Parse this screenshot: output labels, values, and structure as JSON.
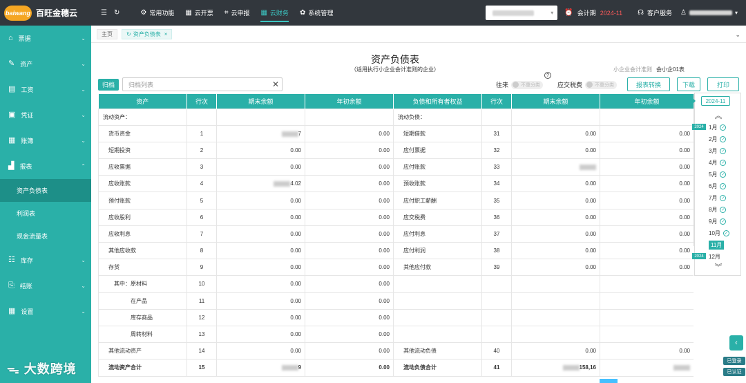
{
  "brand": {
    "logo": "baiwang",
    "name": "百旺金穗云"
  },
  "nav": {
    "items": [
      {
        "label": "常用功能",
        "icon": "sliders-icon"
      },
      {
        "label": "云开票",
        "icon": "grid-icon"
      },
      {
        "label": "云申报",
        "icon": "crop-icon"
      },
      {
        "label": "云财务",
        "icon": "grid-icon"
      },
      {
        "label": "系统管理",
        "icon": "gear-icon"
      }
    ],
    "active_index": 3
  },
  "header": {
    "period_label": "会计期",
    "period_value": "2024-11",
    "service_label": "客户服务"
  },
  "sidebar": {
    "items": [
      {
        "label": "票据"
      },
      {
        "label": "资产"
      },
      {
        "label": "工资"
      },
      {
        "label": "凭证"
      },
      {
        "label": "账簿"
      },
      {
        "label": "报表"
      }
    ],
    "sub_items": [
      {
        "label": "资产负债表"
      },
      {
        "label": "利润表"
      },
      {
        "label": "现金流量表"
      }
    ],
    "bottom_items": [
      {
        "label": "库存"
      },
      {
        "label": "结账"
      },
      {
        "label": "设置"
      }
    ]
  },
  "tabs": [
    {
      "label": "主页"
    },
    {
      "label": "资产负债表"
    }
  ],
  "report": {
    "title": "资产负债表",
    "subtitle": "（适用执行小企业会计准则的企业）",
    "standard_label": "小企业会计准则",
    "standard_value": "会小企01表"
  },
  "toolbar": {
    "archive_button": "归档",
    "archive_placeholder": "归档列表",
    "toggle1_label": "往来",
    "toggle2_label": "应交税费",
    "toggle_text": "不重分类",
    "convert_button": "报表转换",
    "download_button": "下载",
    "print_button": "打印"
  },
  "table": {
    "headers": [
      "资产",
      "行次",
      "期末余额",
      "年初余额",
      "负债和所有者权益",
      "行次",
      "期末余额",
      "年初余额"
    ],
    "rows": [
      {
        "a": "流动资产：",
        "an": "",
        "ae": "",
        "ab": "",
        "l": "流动负债：",
        "ln": "",
        "le": "",
        "lb": "",
        "ai": 0,
        "li": 0
      },
      {
        "a": "货币资金",
        "an": "1",
        "ae": "7",
        "ab": "0.00",
        "l": "短期借款",
        "ln": "31",
        "le": "0.00",
        "lb": "0.00",
        "ai": 1,
        "li": 1,
        "ae_blur": true
      },
      {
        "a": "短期投资",
        "an": "2",
        "ae": "0.00",
        "ab": "0.00",
        "l": "应付票据",
        "ln": "32",
        "le": "0.00",
        "lb": "0.00",
        "ai": 1,
        "li": 1
      },
      {
        "a": "应收票据",
        "an": "3",
        "ae": "0.00",
        "ab": "0.00",
        "l": "应付账款",
        "ln": "33",
        "le": "",
        "lb": "0.00",
        "ai": 1,
        "li": 1,
        "le_blur": true
      },
      {
        "a": "应收账款",
        "an": "4",
        "ae": "4.02",
        "ab": "0.00",
        "l": "预收账款",
        "ln": "34",
        "le": "0.00",
        "lb": "0.00",
        "ai": 1,
        "li": 1,
        "ae_blur": true
      },
      {
        "a": "预付账款",
        "an": "5",
        "ae": "0.00",
        "ab": "0.00",
        "l": "应付职工薪酬",
        "ln": "35",
        "le": "0.00",
        "lb": "0.00",
        "ai": 1,
        "li": 1
      },
      {
        "a": "应收股利",
        "an": "6",
        "ae": "0.00",
        "ab": "0.00",
        "l": "应交税费",
        "ln": "36",
        "le": "0.00",
        "lb": "0.00",
        "ai": 1,
        "li": 1
      },
      {
        "a": "应收利息",
        "an": "7",
        "ae": "0.00",
        "ab": "0.00",
        "l": "应付利息",
        "ln": "37",
        "le": "0.00",
        "lb": "0.00",
        "ai": 1,
        "li": 1
      },
      {
        "a": "其他应收款",
        "an": "8",
        "ae": "0.00",
        "ab": "0.00",
        "l": "应付利润",
        "ln": "38",
        "le": "0.00",
        "lb": "0.00",
        "ai": 1,
        "li": 1
      },
      {
        "a": "存货",
        "an": "9",
        "ae": "0.00",
        "ab": "0.00",
        "l": "其他应付款",
        "ln": "39",
        "le": "0.00",
        "lb": "0.00",
        "ai": 1,
        "li": 1
      },
      {
        "a": "其中：原材料",
        "an": "10",
        "ae": "0.00",
        "ab": "0.00",
        "l": "",
        "ln": "",
        "le": "",
        "lb": "",
        "ai": 2,
        "li": 1
      },
      {
        "a": "在产品",
        "an": "11",
        "ae": "0.00",
        "ab": "0.00",
        "l": "",
        "ln": "",
        "le": "",
        "lb": "",
        "ai": 3,
        "li": 1
      },
      {
        "a": "库存商品",
        "an": "12",
        "ae": "0.00",
        "ab": "0.00",
        "l": "",
        "ln": "",
        "le": "",
        "lb": "",
        "ai": 3,
        "li": 1
      },
      {
        "a": "周转材料",
        "an": "13",
        "ae": "0.00",
        "ab": "0.00",
        "l": "",
        "ln": "",
        "le": "",
        "lb": "",
        "ai": 3,
        "li": 1
      },
      {
        "a": "其他流动资产",
        "an": "14",
        "ae": "0.00",
        "ab": "0.00",
        "l": "其他流动负债",
        "ln": "40",
        "le": "0.00",
        "lb": "0.00",
        "ai": 1,
        "li": 1
      },
      {
        "a": "流动资产合计",
        "an": "15",
        "ae": "9",
        "ab": "0.00",
        "l": "流动负债合计",
        "ln": "41",
        "le": "158,16",
        "lb": "",
        "ai": 1,
        "li": 1,
        "total": true,
        "ae_blur": true,
        "le_blur": true,
        "lb_blur": true
      }
    ]
  },
  "month_panel": {
    "year": "2024-11",
    "year_badge": "2024",
    "months": [
      "1月",
      "2月",
      "3月",
      "4月",
      "5月",
      "6月",
      "7月",
      "8月",
      "9月",
      "10月",
      "11月",
      "12月"
    ],
    "current_index": 10
  },
  "badges": [
    "已登录",
    "已认证"
  ],
  "watermark": "大数跨境"
}
